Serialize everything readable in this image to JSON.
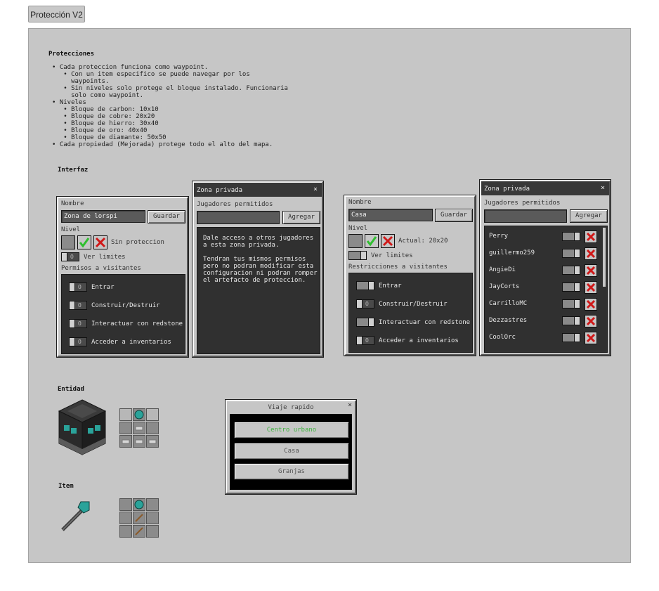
{
  "tab": {
    "label": "Protección V2"
  },
  "protecciones": {
    "heading": "Protecciones",
    "lines": [
      "• Cada proteccion funciona como waypoint.",
      "   • Con un item especifico se puede navegar por los",
      "     waypoints.",
      "   • Sin niveles solo protege el bloque instalado. Funcionaria",
      "     solo como waypoint.",
      "• Niveles",
      "   • Bloque de carbon: 10x10",
      "   • Bloque de cobre: 20x20",
      "   • Bloque de hierro: 30x40",
      "   • Bloque de oro: 40x40",
      "   • Bloque de diamante: 50x50",
      "• Cada propiedad (Mejorada) protege todo el alto del mapa."
    ]
  },
  "interfaz": {
    "heading": "Interfaz"
  },
  "left_panel": {
    "nombre_label": "Nombre",
    "nombre_value": "Zona de lorspi",
    "guardar": "Guardar",
    "nivel_label": "Nivel",
    "nivel_status": "Sin proteccion",
    "ver_limites": "Ver limites",
    "permisos_label": "Permisos a visitantes",
    "permisos": [
      "Entrar",
      "Construir/Destruir",
      "Interactuar con redstone",
      "Acceder a inventarios"
    ]
  },
  "left_zone": {
    "title": "Zona privada",
    "close": "×",
    "jugadores_label": "Jugadores permitidos",
    "agregar": "Agregar",
    "info_1": "Dale acceso a otros jugadores\na esta zona privada.",
    "info_2": "Tendran tus mismos permisos\npero no podran modificar esta\nconfiguracion ni podran romper\nel artefacto de proteccion."
  },
  "right_panel": {
    "nombre_label": "Nombre",
    "nombre_value": "Casa",
    "guardar": "Guardar",
    "nivel_label": "Nivel",
    "nivel_status": "Actual: 20x20",
    "ver_limites": "Ver limites",
    "restricciones_label": "Restricciones a visitantes",
    "permisos": [
      "Entrar",
      "Construir/Destruir",
      "Interactuar con redstone",
      "Acceder a inventarios"
    ]
  },
  "right_zone": {
    "title": "Zona privada",
    "close": "×",
    "jugadores_label": "Jugadores permitidos",
    "agregar": "Agregar",
    "players": [
      "Perry",
      "guillermo259",
      "AngieDi",
      "JayCorts",
      "CarrilloMC",
      "Dezzastres",
      "CoolOrc"
    ]
  },
  "entidad": {
    "heading": "Entidad"
  },
  "item": {
    "heading": "Item"
  },
  "viaje": {
    "title": "Viaje rapido",
    "close": "×",
    "destinations": [
      "Centro urbano",
      "Casa",
      "Granjas"
    ],
    "active_color": "#3db33d"
  },
  "colors": {
    "check": "#2fbf2f",
    "cross": "#d01818",
    "teal": "#2aa39a"
  }
}
